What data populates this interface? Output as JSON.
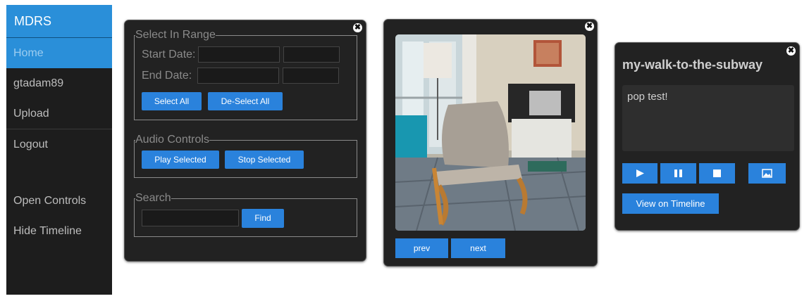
{
  "nav": {
    "brand": "MDRS",
    "items": [
      {
        "label": "Home"
      },
      {
        "label": "gtadam89"
      },
      {
        "label": "Upload"
      },
      {
        "label": "Logout"
      },
      {
        "label": "Open Controls"
      },
      {
        "label": "Hide Timeline"
      }
    ]
  },
  "controls": {
    "close_glyph": "✖",
    "range": {
      "legend": "Select In Range",
      "start_label": "Start Date:",
      "end_label": "End Date:",
      "start_date": "",
      "start_time": "",
      "end_date": "",
      "end_time": "",
      "select_all": "Select All",
      "deselect_all": "De-Select All"
    },
    "audio": {
      "legend": "Audio Controls",
      "play_selected": "Play Selected",
      "stop_selected": "Stop Selected"
    },
    "search": {
      "legend": "Search",
      "value": "",
      "find": "Find"
    }
  },
  "viewer": {
    "close_glyph": "✖",
    "image_icon": "photo-office-chair",
    "prev": "prev",
    "next": "next"
  },
  "card": {
    "close_glyph": "✖",
    "title": "my-walk-to-the-subway",
    "note": "pop test!",
    "view_on_timeline": "View on Timeline",
    "icons": [
      "play-icon",
      "pause-icon",
      "stop-icon",
      "image-icon"
    ]
  },
  "colors": {
    "accent": "#2a82dc",
    "brand": "#2a8fd9",
    "sidebar_bg": "#1d1d1d",
    "panel_bg": "#222222"
  }
}
